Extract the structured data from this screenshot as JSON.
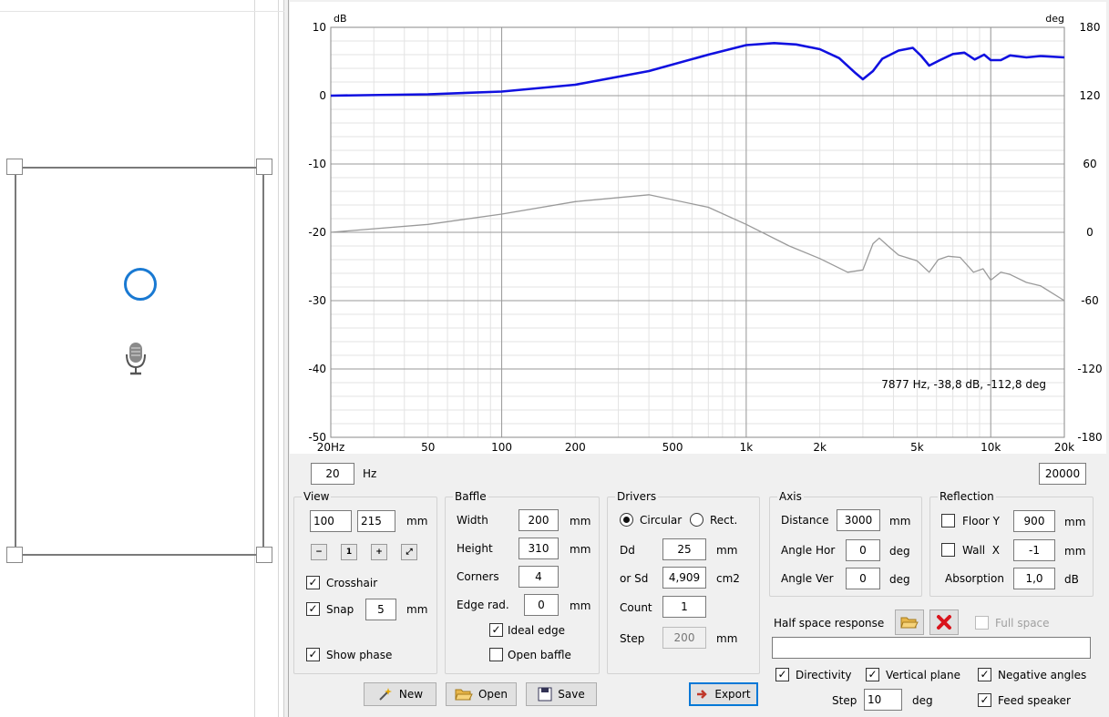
{
  "chart_data": {
    "type": "line",
    "x_scale": "log",
    "xlim": [
      20,
      20000
    ],
    "ylim": [
      -50,
      10
    ],
    "y2lim": [
      -180,
      180
    ],
    "ylabel": "dB",
    "y2label": "deg",
    "x_ticks": [
      {
        "v": 20,
        "label": "20Hz"
      },
      {
        "v": 50,
        "label": "50"
      },
      {
        "v": 100,
        "label": "100"
      },
      {
        "v": 200,
        "label": "200"
      },
      {
        "v": 500,
        "label": "500"
      },
      {
        "v": 1000,
        "label": "1k"
      },
      {
        "v": 2000,
        "label": "2k"
      },
      {
        "v": 5000,
        "label": "5k"
      },
      {
        "v": 10000,
        "label": "10k"
      },
      {
        "v": 20000,
        "label": "20k"
      }
    ],
    "y_ticks": [
      10,
      0,
      -10,
      -20,
      -30,
      -40,
      -50
    ],
    "y2_ticks": [
      180,
      120,
      60,
      0,
      -60,
      -120,
      -180
    ],
    "grid": true,
    "series": [
      {
        "color": "#1010e0",
        "axis": "left",
        "x": [
          20,
          50,
          100,
          200,
          400,
          700,
          1000,
          1300,
          1600,
          2000,
          2400,
          2800,
          3000,
          3300,
          3600,
          4200,
          4800,
          5200,
          5600,
          6200,
          7000,
          7800,
          8600,
          9400,
          10000,
          11000,
          12000,
          14000,
          16000,
          20000
        ],
        "y": [
          0,
          0.2,
          0.6,
          1.6,
          3.6,
          6,
          7.4,
          7.7,
          7.5,
          6.8,
          5.5,
          3.3,
          2.4,
          3.6,
          5.4,
          6.6,
          7,
          5.8,
          4.4,
          5.2,
          6.1,
          6.3,
          5.3,
          6,
          5.2,
          5.2,
          5.9,
          5.6,
          5.8,
          5.6
        ]
      },
      {
        "color": "#9a9a9a",
        "axis": "right",
        "x": [
          20,
          50,
          100,
          200,
          400,
          700,
          1000,
          1500,
          2000,
          2600,
          3000,
          3300,
          3500,
          3800,
          4200,
          5000,
          5600,
          6100,
          6700,
          7500,
          8500,
          9300,
          10000,
          11000,
          12000,
          14000,
          16000,
          20000
        ],
        "y": [
          0,
          7,
          16,
          27,
          33,
          22,
          7,
          -12,
          -23,
          -35,
          -33,
          -10,
          -5,
          -12,
          -20,
          -25,
          -35,
          -24,
          -21,
          -22,
          -35,
          -32,
          -42,
          -35,
          -37,
          -44,
          -47,
          -60
        ]
      }
    ],
    "annotation": "7877 Hz, -38,8 dB, -112,8 deg"
  },
  "freq_min": "20",
  "freq_unit": "Hz",
  "freq_max": "20000",
  "view": {
    "title": "View",
    "x": "100",
    "y": "215",
    "unit": "mm",
    "zoom_buttons": [
      "zoom-out-icon",
      "zoom-reset-icon",
      "zoom-in-icon",
      "fit-icon"
    ],
    "crosshair_label": "Crosshair",
    "crosshair_checked": true,
    "snap_label": "Snap",
    "snap_checked": true,
    "snap_value": "5",
    "snap_unit": "mm",
    "show_phase_label": "Show phase",
    "show_phase_checked": true
  },
  "baffle": {
    "title": "Baffle",
    "width_label": "Width",
    "width": "200",
    "width_unit": "mm",
    "height_label": "Height",
    "height": "310",
    "height_unit": "mm",
    "corners_label": "Corners",
    "corners": "4",
    "edge_label": "Edge rad.",
    "edge": "0",
    "edge_unit": "mm",
    "ideal_edge_label": "Ideal edge",
    "ideal_edge_checked": true,
    "open_baffle_label": "Open baffle",
    "open_baffle_checked": false
  },
  "drivers": {
    "title": "Drivers",
    "circular_label": "Circular",
    "rect_label": "Rect.",
    "dd_label": "Dd",
    "dd": "25",
    "dd_unit": "mm",
    "sd_label": "or Sd",
    "sd": "4,909",
    "sd_unit": "cm2",
    "count_label": "Count",
    "count": "1",
    "step_label": "Step",
    "step": "200",
    "step_unit": "mm"
  },
  "axis": {
    "title": "Axis",
    "distance_label": "Distance",
    "distance": "3000",
    "distance_unit": "mm",
    "angle_hor_label": "Angle Hor",
    "angle_hor": "0",
    "angle_hor_unit": "deg",
    "angle_ver_label": "Angle Ver",
    "angle_ver": "0",
    "angle_ver_unit": "deg"
  },
  "reflection": {
    "title": "Reflection",
    "floor_label": "Floor Y",
    "floor": "900",
    "floor_unit": "mm",
    "wall_label": "Wall  X",
    "wall": "-1",
    "wall_unit": "mm",
    "absorption_label": "Absorption",
    "absorption": "1,0",
    "absorption_unit": "dB"
  },
  "half_space": {
    "label": "Half space response",
    "full_space_label": "Full space",
    "path": ""
  },
  "directivity": {
    "directivity_label": "Directivity",
    "vertical_label": "Vertical plane",
    "negative_label": "Negative angles",
    "step_label": "Step",
    "step": "10",
    "step_unit": "deg",
    "feed_label": "Feed speaker"
  },
  "buttons": {
    "new_label": "New",
    "open_label": "Open",
    "save_label": "Save",
    "export_label": "Export"
  }
}
